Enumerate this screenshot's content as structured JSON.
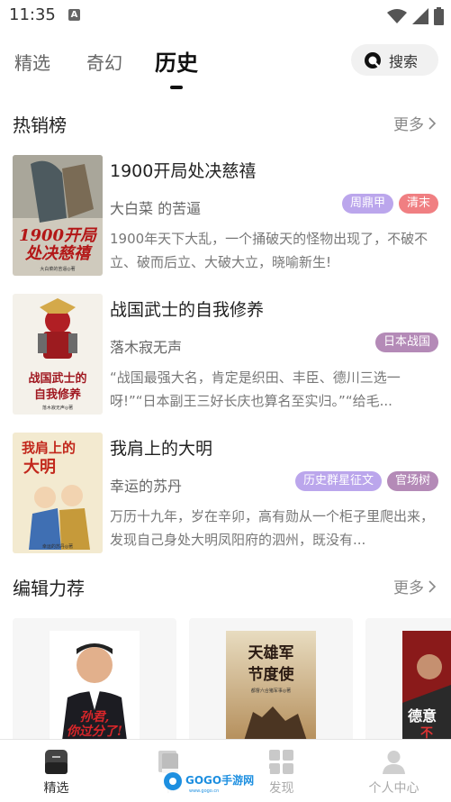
{
  "status_bar": {
    "time": "11:35",
    "notification_badge": "A"
  },
  "top_tabs": [
    {
      "label": "精选",
      "active": false
    },
    {
      "label": "奇幻",
      "active": false
    },
    {
      "label": "历史",
      "active": true
    }
  ],
  "search": {
    "label": "搜索"
  },
  "hot_section": {
    "title": "热销榜",
    "more": "更多"
  },
  "books": [
    {
      "title": "1900开局处决慈禧",
      "author": "大白菜 的苦逼",
      "tags": [
        {
          "text": "周鼎甲",
          "color": "#bba6ec"
        },
        {
          "text": "清末",
          "color": "#f07f82"
        }
      ],
      "desc": "1900年天下大乱，一个捅破天的怪物出现了，不破不立、破而后立、大破大立，晓喻新生!",
      "cover_text": "1900开局处决慈禧",
      "cover_author": "大白菜的苦逼◎著"
    },
    {
      "title": "战国武士的自我修养",
      "author": "落木寂无声",
      "tags": [
        {
          "text": "日本战国",
          "color": "#b48ab7"
        }
      ],
      "desc": "“战国最强大名，肯定是织田、丰臣、德川三选一呀!”“日本副王三好长庆也算名至实归。”“给毛...",
      "cover_text": "战国武士的自我修养",
      "cover_author": "落木寂无声◎著"
    },
    {
      "title": "我肩上的大明",
      "author": "幸运的苏丹",
      "tags": [
        {
          "text": "历史群星征文",
          "color": "#bba6ec"
        },
        {
          "text": "官场树",
          "color": "#b48ab7"
        }
      ],
      "desc": "万历十九年，岁在辛卯，高有勋从一个柜子里爬出来，发现自己身处大明凤阳府的泗州，既没有...",
      "cover_text": "我肩上的大明",
      "cover_author": "幸运的苏丹◎著"
    }
  ],
  "editor_section": {
    "title": "编辑力荐",
    "more": "更多"
  },
  "recommendations": [
    {
      "cover_text": "孙君,你过分了!"
    },
    {
      "cover_text": "天雄军节度使",
      "cover_author": "都督六合猪军事◎著"
    },
    {
      "cover_text": "德意志不..."
    }
  ],
  "bottom_nav": [
    {
      "label": "精选",
      "active": true
    },
    {
      "label": "书",
      "active": false
    },
    {
      "label": "发现",
      "active": false
    },
    {
      "label": "个人中心",
      "active": false
    }
  ],
  "watermark": {
    "brand": "GOGO手游网",
    "site": "www.gogo.cn"
  },
  "colors": {
    "tag_purple": "#bba6ec",
    "tag_red": "#f07f82",
    "tag_mauve": "#b48ab7",
    "nav_active": "#333333"
  }
}
